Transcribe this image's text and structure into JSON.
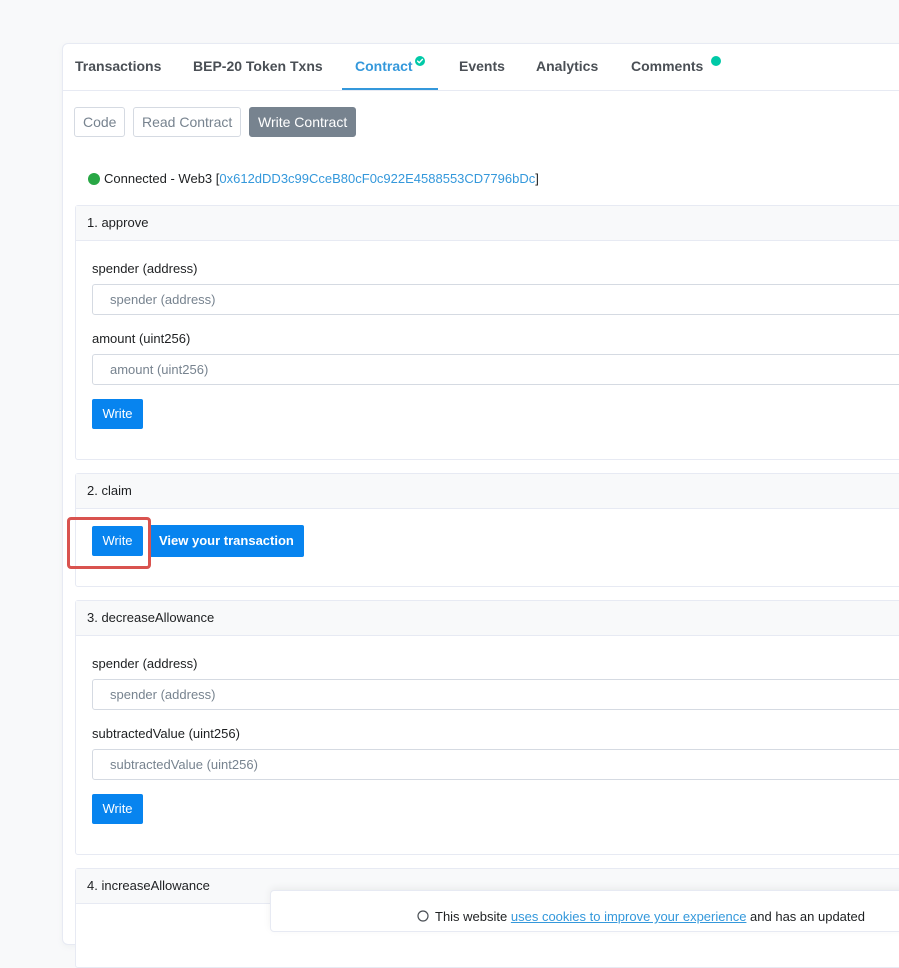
{
  "tabs": [
    {
      "label": "Transactions",
      "active": false
    },
    {
      "label": "BEP-20 Token Txns",
      "active": false
    },
    {
      "label": "Contract",
      "active": true,
      "icon": "verified-check-icon"
    },
    {
      "label": "Events",
      "active": false
    },
    {
      "label": "Analytics",
      "active": false
    },
    {
      "label": "Comments",
      "active": false,
      "badge": "green-dot"
    }
  ],
  "subtabs": {
    "code": "Code",
    "read": "Read Contract",
    "write": "Write Contract",
    "active": "Write Contract"
  },
  "connection": {
    "status_text": "Connected - Web3 [",
    "address": "0x612dDD3c99CceB80cF0c922E4588553CD7796bDc",
    "suffix": "]"
  },
  "functions": [
    {
      "title": "1. approve",
      "inputs": [
        {
          "label": "spender (address)",
          "placeholder": "spender (address)"
        },
        {
          "label": "amount (uint256)",
          "placeholder": "amount (uint256)"
        }
      ],
      "button": "Write"
    },
    {
      "title": "2. claim",
      "inputs": [],
      "button": "Write",
      "secondary_button": "View your transaction"
    },
    {
      "title": "3. decreaseAllowance",
      "inputs": [
        {
          "label": "spender (address)",
          "placeholder": "spender (address)"
        },
        {
          "label": "subtractedValue (uint256)",
          "placeholder": "subtractedValue (uint256)"
        }
      ],
      "button": "Write"
    },
    {
      "title": "4. increaseAllowance",
      "inputs": [],
      "button": ""
    }
  ],
  "cookie_banner": {
    "prefix": "This website ",
    "link": "uses cookies to improve your experience",
    "suffix": " and has an updated"
  },
  "colors": {
    "accent": "#3498db",
    "primary_button": "#0784ef",
    "connected_dot": "#28a745",
    "highlight": "#d9534f"
  }
}
